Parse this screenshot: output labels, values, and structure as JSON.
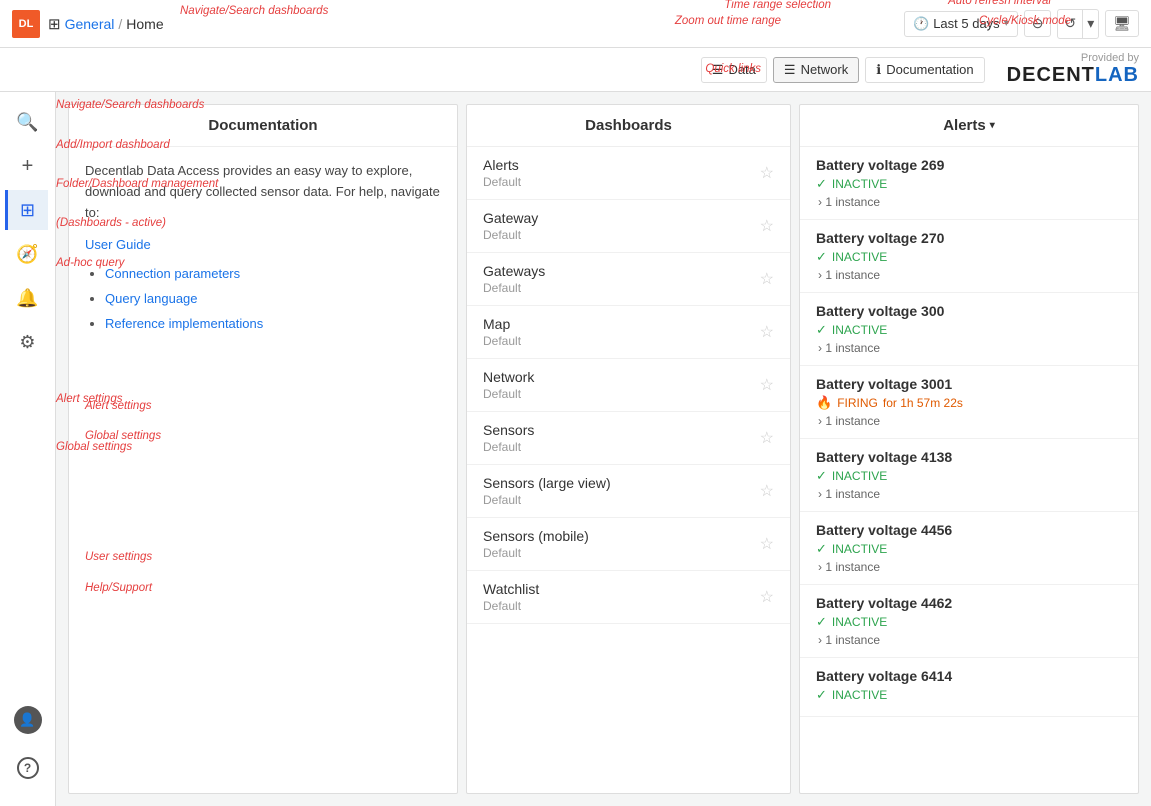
{
  "app": {
    "logo": "DL",
    "breadcrumb": {
      "icon": "⊞",
      "parts": [
        "General",
        "/",
        "Home"
      ]
    }
  },
  "topbar": {
    "time_range_label": "Last 5 days",
    "zoom_out_label": "⊖",
    "refresh_icon": "↺",
    "auto_refresh_dropdown": "▾",
    "kiosk_icon": "⬜",
    "time_icon": "🕐"
  },
  "annotations": {
    "time_range_selection": "Time range selection",
    "auto_refresh_interval": "Auto refresh interval",
    "zoom_out_time_range": "Zoom out time range",
    "cycle_kiosk_mode": "Cycle/Kiosk mode",
    "quick_links": "Quick links",
    "navigate_search": "Navigate/Search dashboards",
    "add_import": "Add/Import dashboard",
    "folder_dashboard": "Folder/Dashboard management",
    "adhoc_query": "Ad-hoc query",
    "alert_settings": "Alert settings",
    "global_settings": "Global settings",
    "user_settings": "User settings",
    "help_support": "Help/Support"
  },
  "quick_links": [
    {
      "id": "data",
      "label": "Data",
      "icon": "☰"
    },
    {
      "id": "network",
      "label": "Network",
      "icon": "☰"
    },
    {
      "id": "documentation",
      "label": "Documentation",
      "icon": "ℹ"
    }
  ],
  "brand": {
    "provided_by": "Provided by",
    "logo_part1": "DECENT",
    "logo_part2": "LAB"
  },
  "sidebar": {
    "items": [
      {
        "id": "search",
        "icon": "🔍",
        "label": "Search"
      },
      {
        "id": "add",
        "icon": "+",
        "label": "Add"
      },
      {
        "id": "dashboards",
        "icon": "⊞",
        "label": "Dashboards",
        "active": true
      },
      {
        "id": "explore",
        "icon": "🧭",
        "label": "Explore"
      },
      {
        "id": "alerts",
        "icon": "🔔",
        "label": "Alerts"
      },
      {
        "id": "settings",
        "icon": "⚙",
        "label": "Settings"
      }
    ],
    "bottom": [
      {
        "id": "user",
        "icon": "👤",
        "label": "User settings"
      },
      {
        "id": "help",
        "icon": "?",
        "label": "Help/Support"
      }
    ]
  },
  "documentation_panel": {
    "title": "Documentation",
    "intro": "Decentlab Data Access provides an easy way to explore, download and query collected sensor data. For help, navigate to:",
    "user_guide_label": "User Guide",
    "links": [
      {
        "id": "connection-parameters",
        "label": "Connection parameters"
      },
      {
        "id": "query-language",
        "label": "Query language"
      },
      {
        "id": "reference-implementations",
        "label": "Reference implementations"
      }
    ]
  },
  "dashboards_panel": {
    "title": "Dashboards",
    "items": [
      {
        "id": "alerts",
        "name": "Alerts",
        "folder": "Default",
        "starred": false
      },
      {
        "id": "gateway",
        "name": "Gateway",
        "folder": "Default",
        "starred": false
      },
      {
        "id": "gateways",
        "name": "Gateways",
        "folder": "Default",
        "starred": false
      },
      {
        "id": "map",
        "name": "Map",
        "folder": "Default",
        "starred": false
      },
      {
        "id": "network",
        "name": "Network",
        "folder": "Default",
        "starred": false
      },
      {
        "id": "sensors",
        "name": "Sensors",
        "folder": "Default",
        "starred": false
      },
      {
        "id": "sensors-large",
        "name": "Sensors (large view)",
        "folder": "Default",
        "starred": false
      },
      {
        "id": "sensors-mobile",
        "name": "Sensors (mobile)",
        "folder": "Default",
        "starred": false
      },
      {
        "id": "watchlist",
        "name": "Watchlist",
        "folder": "Default",
        "starred": false
      }
    ]
  },
  "alerts_panel": {
    "title": "Alerts",
    "dropdown_icon": "▾",
    "items": [
      {
        "id": "bv-269",
        "name": "Battery voltage 269",
        "status": "INACTIVE",
        "status_type": "inactive",
        "extra": "",
        "instance_label": "› 1 instance"
      },
      {
        "id": "bv-270",
        "name": "Battery voltage 270",
        "status": "INACTIVE",
        "status_type": "inactive",
        "extra": "",
        "instance_label": "› 1 instance"
      },
      {
        "id": "bv-300",
        "name": "Battery voltage 300",
        "status": "INACTIVE",
        "status_type": "inactive",
        "extra": "",
        "instance_label": "› 1 instance"
      },
      {
        "id": "bv-3001",
        "name": "Battery voltage 3001",
        "status": "FIRING",
        "status_type": "firing",
        "extra": "for 1h 57m 22s",
        "instance_label": "› 1 instance"
      },
      {
        "id": "bv-4138",
        "name": "Battery voltage 4138",
        "status": "INACTIVE",
        "status_type": "inactive",
        "extra": "",
        "instance_label": "› 1 instance"
      },
      {
        "id": "bv-4456",
        "name": "Battery voltage 4456",
        "status": "INACTIVE",
        "status_type": "inactive",
        "extra": "",
        "instance_label": "› 1 instance"
      },
      {
        "id": "bv-4462",
        "name": "Battery voltage 4462",
        "status": "INACTIVE",
        "status_type": "inactive",
        "extra": "",
        "instance_label": "› 1 instance"
      },
      {
        "id": "bv-6414",
        "name": "Battery voltage 6414",
        "status": "INACTIVE",
        "status_type": "inactive",
        "extra": "",
        "instance_label": ""
      }
    ]
  }
}
